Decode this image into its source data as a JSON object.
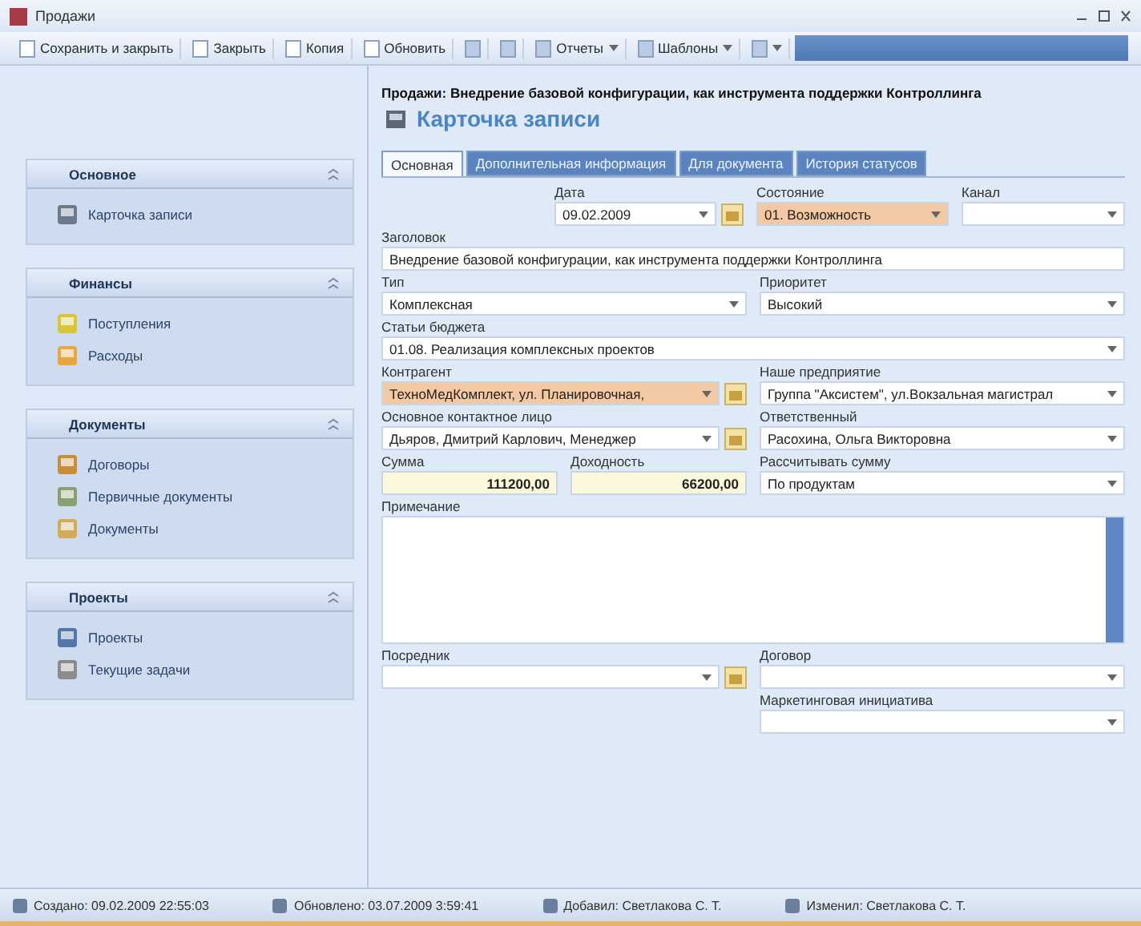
{
  "window": {
    "title": "Продажи"
  },
  "toolbar": [
    {
      "label": "Сохранить и закрыть",
      "kind": "text"
    },
    {
      "label": "Закрыть",
      "kind": "text"
    },
    {
      "label": "Копия",
      "kind": "text"
    },
    {
      "label": "Обновить",
      "kind": "text"
    },
    {
      "kind": "icon"
    },
    {
      "kind": "icon"
    },
    {
      "label": "Отчеты",
      "kind": "menu"
    },
    {
      "label": "Шаблоны",
      "kind": "menu"
    },
    {
      "kind": "iconmenu"
    }
  ],
  "sidebar": {
    "groups": [
      {
        "title": "Основное",
        "items": [
          "Карточка записи"
        ]
      },
      {
        "title": "Финансы",
        "items": [
          "Поступления",
          "Расходы"
        ]
      },
      {
        "title": "Документы",
        "items": [
          "Договоры",
          "Первичные документы",
          "Документы"
        ]
      },
      {
        "title": "Проекты",
        "items": [
          "Проекты",
          "Текущие задачи"
        ]
      }
    ]
  },
  "record": {
    "caption": "Продажи: Внедрение базовой конфигурации, как инструмента поддержки Контроллинга",
    "title": "Карточка записи"
  },
  "tabs": [
    {
      "label": "Основная",
      "selected": true
    },
    {
      "label": "Дополнительная информация",
      "selected": false
    },
    {
      "label": "Для документа",
      "selected": false
    },
    {
      "label": "История статусов",
      "selected": false
    }
  ],
  "form": {
    "rows": [
      [
        {
          "kind": "blank"
        },
        {
          "label": "Дата",
          "value": "09.02.2009",
          "kind": "date",
          "highlighted": false
        },
        {
          "label": "Состояние",
          "value": "01. Возможность",
          "kind": "dropdown",
          "highlighted": true
        },
        {
          "label": "Канал",
          "kind": "dropdown",
          "highlighted": false
        }
      ],
      [
        {
          "label": "Заголовок",
          "value": "Внедрение базовой конфигурации, как инструмента поддержки Контроллинга",
          "kind": "text",
          "highlighted": false
        }
      ],
      [
        {
          "label": "Тип",
          "value": "Комплексная",
          "kind": "dropdown",
          "highlighted": false
        },
        {
          "label": "Приоритет",
          "value": "Высокий",
          "kind": "dropdown",
          "highlighted": false
        }
      ],
      [
        {
          "label": "Статьи бюджета",
          "value": "01.08. Реализация комплексных проектов",
          "kind": "dropdown",
          "highlighted": false
        }
      ],
      [
        {
          "label": "Контрагент",
          "value": "ТехноМедКомплект, ул. Планировочная,",
          "kind": "lookup",
          "highlighted": true
        },
        {
          "label": "Наше предприятие",
          "value": "Группа \"Аксистем\", ул.Вокзальная магистрал",
          "kind": "dropdown",
          "highlighted": false
        }
      ],
      [
        {
          "label": "Основное контактное лицо",
          "value": "Дьяров, Дмитрий Карлович, Менеджер",
          "kind": "lookup",
          "highlighted": false
        },
        {
          "label": "Ответственный",
          "value": "Расохина, Ольга Викторовна",
          "kind": "dropdown",
          "highlighted": false
        }
      ],
      [
        {
          "label": "Сумма",
          "value": "111200,00",
          "kind": "number",
          "highlighted": false
        },
        {
          "label": "Доходность",
          "value": "66200,00",
          "kind": "number",
          "highlighted": false
        },
        {
          "label": "Рассчитывать сумму",
          "value": "По продуктам",
          "kind": "dropdown",
          "highlighted": false
        }
      ],
      [
        {
          "label": "Примечание",
          "kind": "memo",
          "highlighted": false
        }
      ],
      [
        {
          "label": "Посредник",
          "kind": "lookup",
          "highlighted": false
        },
        {
          "label": "Договор",
          "kind": "dropdown",
          "highlighted": false
        }
      ],
      [
        {
          "kind": "blank"
        },
        {
          "label": "Маркетинговая инициатива",
          "kind": "dropdown",
          "highlighted": false
        }
      ]
    ]
  },
  "status_bar": [
    "Создано: 09.02.2009 22:55:03",
    "Обновлено: 03.07.2009 3:59:41",
    "Добавил: Светлакова С. Т.",
    "Изменил: Светлакова С. Т."
  ]
}
